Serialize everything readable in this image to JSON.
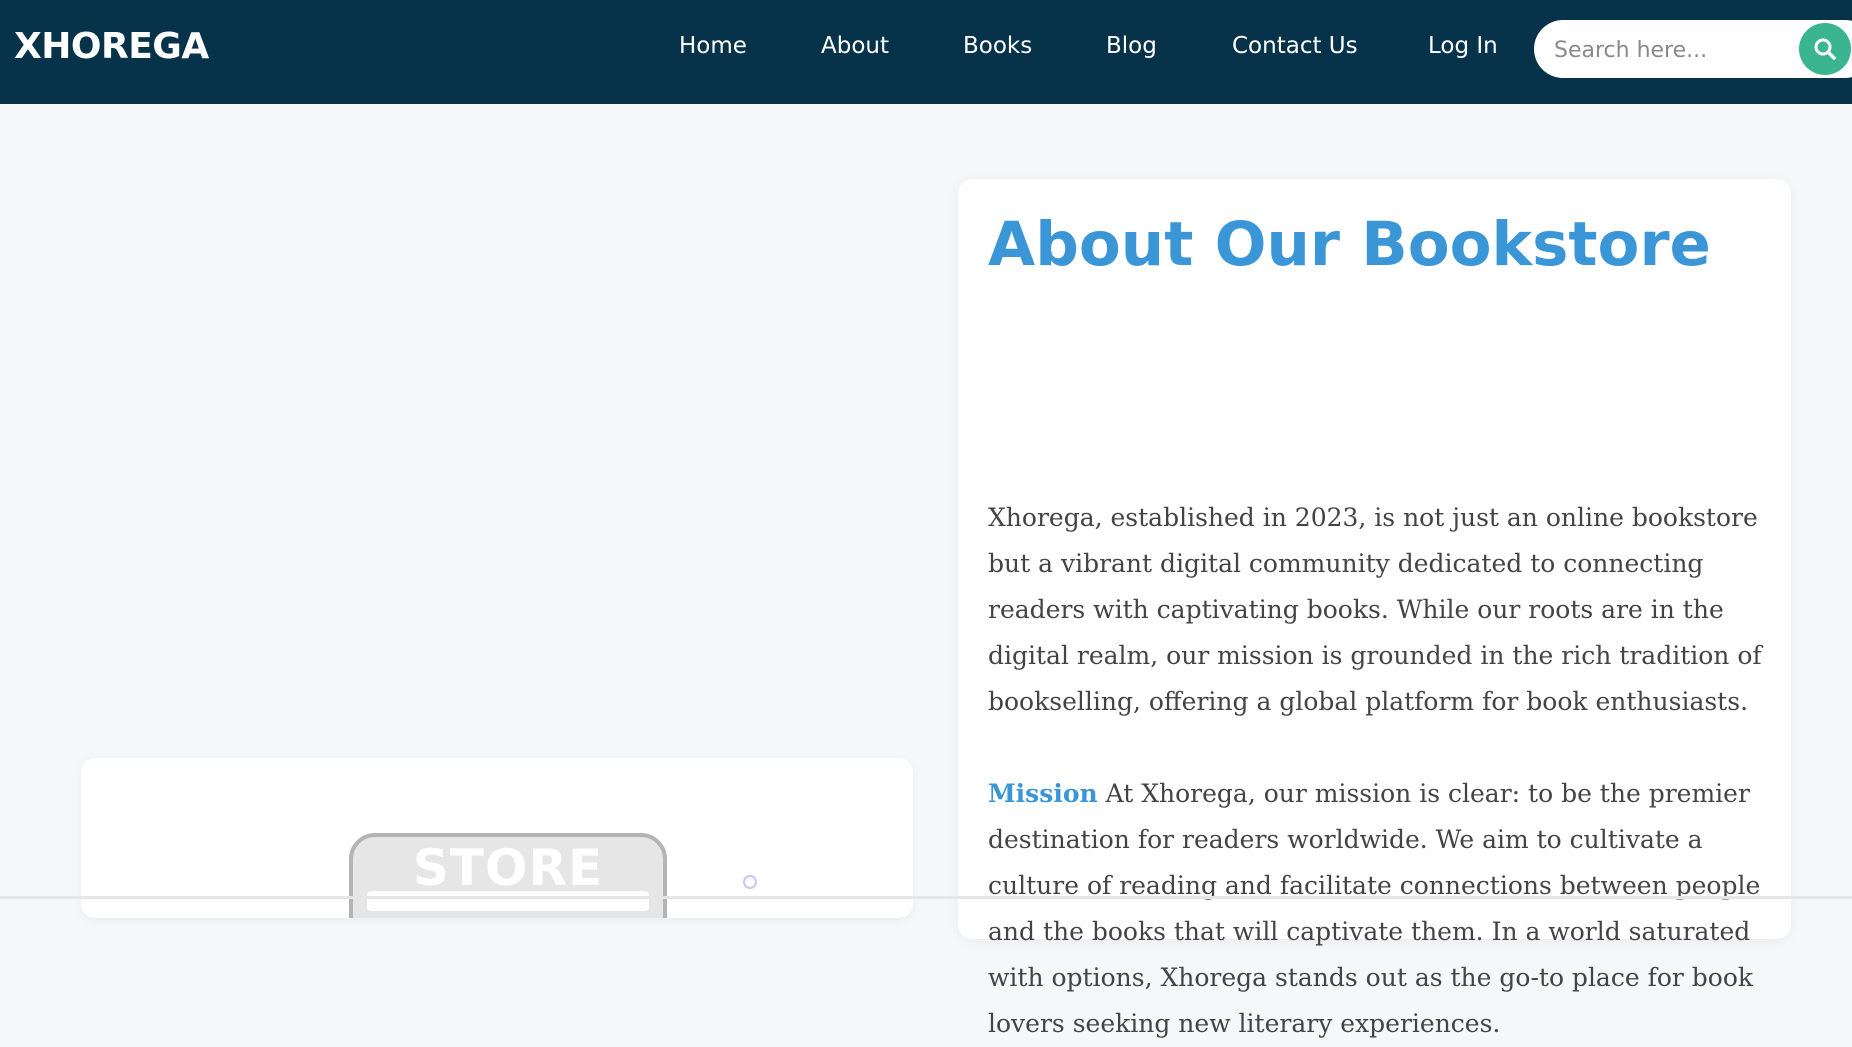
{
  "navbar": {
    "brand": "XHOREGA",
    "links": [
      "Home",
      "About",
      "Books",
      "Blog",
      "Contact Us",
      "Log In"
    ],
    "search_placeholder": "Search here...",
    "search_icon": "search-icon"
  },
  "image_card": {
    "sign_text": "STORE"
  },
  "about": {
    "title": "About Our Bookstore",
    "intro": "Xhorega, established in 2023, is not just an online bookstore but a vibrant digital community dedicated to connecting readers with captivating books. While our roots are in the digital realm, our mission is grounded in the rich tradition of bookselling, offering a global platform for book enthusiasts.",
    "mission_label": "Mission",
    "mission_text": " At Xhorega, our mission is clear: to be the premier destination for readers worldwide. We aim to cultivate a culture of reading and facilitate connections between people and the books that will captivate them. In a world saturated with options, Xhorega stands out as the go-to place for book lovers seeking new literary experiences."
  },
  "colors": {
    "navbar_bg": "#063349",
    "accent_blue": "#3a96d6",
    "search_button": "#3bb58f",
    "page_bg": "#f6f7f9"
  }
}
